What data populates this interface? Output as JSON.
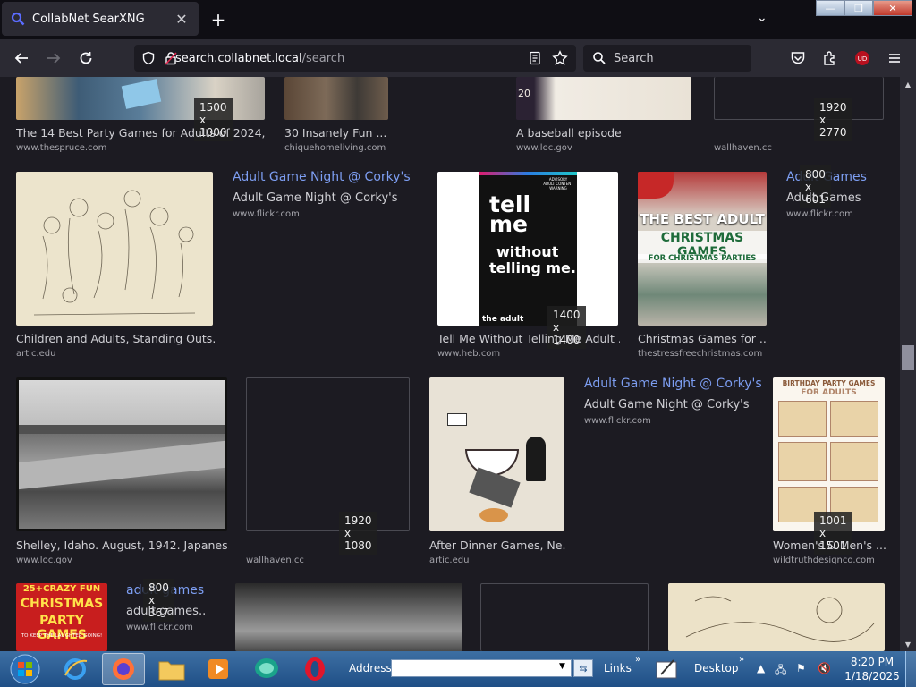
{
  "browser": {
    "tab_title": "CollabNet SearXNG",
    "url_host": "search.collabnet.local",
    "url_path": "/search",
    "search_placeholder": "Search",
    "new_tab": "+",
    "tab_close": "✕",
    "tab_list": "⌄",
    "min": "—",
    "max": "❐",
    "close": "✕"
  },
  "results": {
    "r1": {
      "title": "The 14 Best Party Games for Adults of 2024, ...",
      "source": "www.thespruce.com",
      "dims": "1500 x 1000"
    },
    "r2": {
      "title": "30 Insanely Fun ...",
      "source": "chiquehomeliving.com"
    },
    "r3": {
      "title": "A baseball episode",
      "source": "www.loc.gov"
    },
    "r4": {
      "source": "wallhaven.cc",
      "dims": "1920 x 2770"
    },
    "r5": {
      "title": "Children and Adults, Standing Outs...",
      "source": "artic.edu"
    },
    "r6": {
      "link": "Adult Game Night @ Corky's",
      "text": "Adult Game Night @ Corky's",
      "source": "www.flickr.com"
    },
    "r7": {
      "title": "Tell Me Without Telling Me Adult ...",
      "source": "www.heb.com",
      "dims": "1400 x 1400",
      "img_big": "tell",
      "img_big2": "me",
      "img_mid": "without",
      "img_mid2": "telling me.",
      "img_small": "the adult",
      "img_badge": "ADVISORY ADULT CONTENT WARNING"
    },
    "r8": {
      "title": "Christmas Games for ...",
      "source": "thestressfreechristmas.com",
      "img_line1": "THE BEST ADULT",
      "img_line2": "CHRISTMAS GAMES",
      "img_line3": "FOR CHRISTMAS PARTIES"
    },
    "r9": {
      "link": "Adult Games",
      "text": "Adult Games",
      "source": "www.flickr.com",
      "dims": "800 x 601"
    },
    "r10": {
      "title": "Shelley, Idaho. August, 1942. Japanes...",
      "source": "www.loc.gov"
    },
    "r11": {
      "source": "wallhaven.cc",
      "dims": "1920 x 1080"
    },
    "r12": {
      "title": "After Dinner Games, Ne...",
      "source": "artic.edu"
    },
    "r13": {
      "link": "Adult Game Night @ Corky's",
      "text": "Adult Game Night @ Corky's",
      "source": "www.flickr.com"
    },
    "r14": {
      "title": "Women's & Men's ...",
      "source": "wildtruthdesignco.com",
      "dims": "1001 x 1501",
      "img_line1": "BIRTHDAY PARTY GAMES",
      "img_line2": "FOR ADULTS"
    },
    "r15": {
      "link": "adult games",
      "text": "adult games..",
      "source": "www.flickr.com",
      "dims": "800 x 367",
      "img_line1": "25+CRAZY FUN",
      "img_line2": "CHRISTMAS",
      "img_line3": "PARTY GAMES",
      "img_line4": "TO KEEP THE LAUGHTER GOING!"
    }
  },
  "taskbar": {
    "address_label": "Address",
    "address_value": "",
    "links_label": "Links",
    "desktop_label": "Desktop",
    "time": "8:20 PM",
    "date": "1/18/2025"
  }
}
